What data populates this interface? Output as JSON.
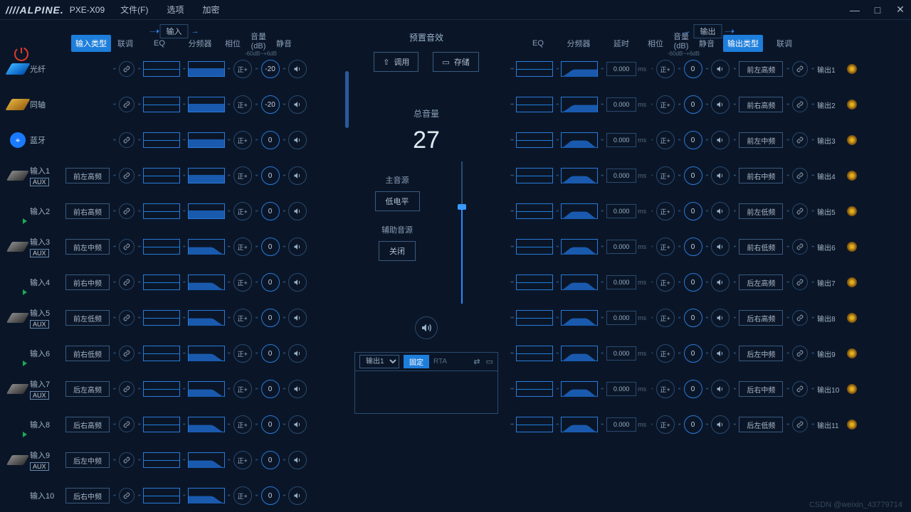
{
  "app": {
    "brand": "////ALPINE.",
    "model": "PXE-X09"
  },
  "menu": {
    "file": "文件(F)",
    "options": "选项",
    "encrypt": "加密"
  },
  "flow": {
    "input": "输入",
    "output": "输出"
  },
  "headers": {
    "inputType": "输入类型",
    "link": "联调",
    "eq": "EQ",
    "xover": "分频器",
    "delay": "延时",
    "phase": "相位",
    "vol": "音量(dB)",
    "volSub": "-60dB~+6dB",
    "mute": "静音",
    "outputType": "输出类型"
  },
  "preset": {
    "title": "预置音效",
    "recall": "调用",
    "save": "存储"
  },
  "master": {
    "volLabel": "总音量",
    "vol": "27",
    "srcLabel": "主音源",
    "srcBtn": "低电平",
    "auxLabel": "辅助音源",
    "auxBtn": "关闭"
  },
  "rta": {
    "select": "输出1",
    "fixed": "固定",
    "label": "RTA"
  },
  "inputs": [
    {
      "icon": "optical",
      "name": "光纤",
      "type": "",
      "xo": "flat",
      "vol": "-20",
      "aux": false,
      "play": false
    },
    {
      "icon": "coax",
      "name": "同轴",
      "type": "",
      "xo": "flat",
      "vol": "-20",
      "aux": false,
      "play": false
    },
    {
      "icon": "bt",
      "name": "蓝牙",
      "type": "",
      "xo": "flat",
      "vol": "0",
      "aux": false,
      "play": false
    },
    {
      "icon": "jack",
      "name": "输入1",
      "type": "前左高频",
      "xo": "flat",
      "vol": "0",
      "aux": true,
      "play": false
    },
    {
      "icon": "",
      "name": "输入2",
      "type": "前右高频",
      "xo": "flat",
      "vol": "0",
      "aux": false,
      "play": true
    },
    {
      "icon": "jack",
      "name": "输入3",
      "type": "前左中频",
      "xo": "low",
      "vol": "0",
      "aux": true,
      "play": false
    },
    {
      "icon": "",
      "name": "输入4",
      "type": "前右中频",
      "xo": "low",
      "vol": "0",
      "aux": false,
      "play": true
    },
    {
      "icon": "jack",
      "name": "输入5",
      "type": "前左低频",
      "xo": "low",
      "vol": "0",
      "aux": true,
      "play": false
    },
    {
      "icon": "",
      "name": "输入6",
      "type": "前右低频",
      "xo": "low",
      "vol": "0",
      "aux": false,
      "play": true
    },
    {
      "icon": "jack",
      "name": "输入7",
      "type": "后左高频",
      "xo": "low",
      "vol": "0",
      "aux": true,
      "play": false
    },
    {
      "icon": "",
      "name": "输入8",
      "type": "后右高频",
      "xo": "low",
      "vol": "0",
      "aux": false,
      "play": true
    },
    {
      "icon": "jack",
      "name": "输入9",
      "type": "后左中频",
      "xo": "low",
      "vol": "0",
      "aux": true,
      "play": false
    },
    {
      "icon": "",
      "name": "输入10",
      "type": "后右中频",
      "xo": "low",
      "vol": "0",
      "aux": false,
      "play": false
    }
  ],
  "outputs": [
    {
      "type": "前左高频",
      "xo": "high",
      "delay": "0.000",
      "vol": "0",
      "out": "输出1"
    },
    {
      "type": "前右高频",
      "xo": "high",
      "delay": "0.000",
      "vol": "0",
      "out": "输出2"
    },
    {
      "type": "前左中频",
      "xo": "band",
      "delay": "0.000",
      "vol": "0",
      "out": "输出3"
    },
    {
      "type": "前右中频",
      "xo": "band",
      "delay": "0.000",
      "vol": "0",
      "out": "输出4"
    },
    {
      "type": "前左低频",
      "xo": "band",
      "delay": "0.000",
      "vol": "0",
      "out": "输出5"
    },
    {
      "type": "前右低频",
      "xo": "band",
      "delay": "0.000",
      "vol": "0",
      "out": "输出6"
    },
    {
      "type": "后左高频",
      "xo": "band",
      "delay": "0.000",
      "vol": "0",
      "out": "输出7"
    },
    {
      "type": "后右高频",
      "xo": "band",
      "delay": "0.000",
      "vol": "0",
      "out": "输出8"
    },
    {
      "type": "后左中频",
      "xo": "band",
      "delay": "0.000",
      "vol": "0",
      "out": "输出9"
    },
    {
      "type": "后右中频",
      "xo": "band",
      "delay": "0.000",
      "vol": "0",
      "out": "输出10"
    },
    {
      "type": "后左低频",
      "xo": "band",
      "delay": "0.000",
      "vol": "0",
      "out": "输出11"
    }
  ],
  "labels": {
    "phase": "正+",
    "ms": "ms",
    "aux": "AUX"
  },
  "watermark": "CSDN @weixin_43779714"
}
